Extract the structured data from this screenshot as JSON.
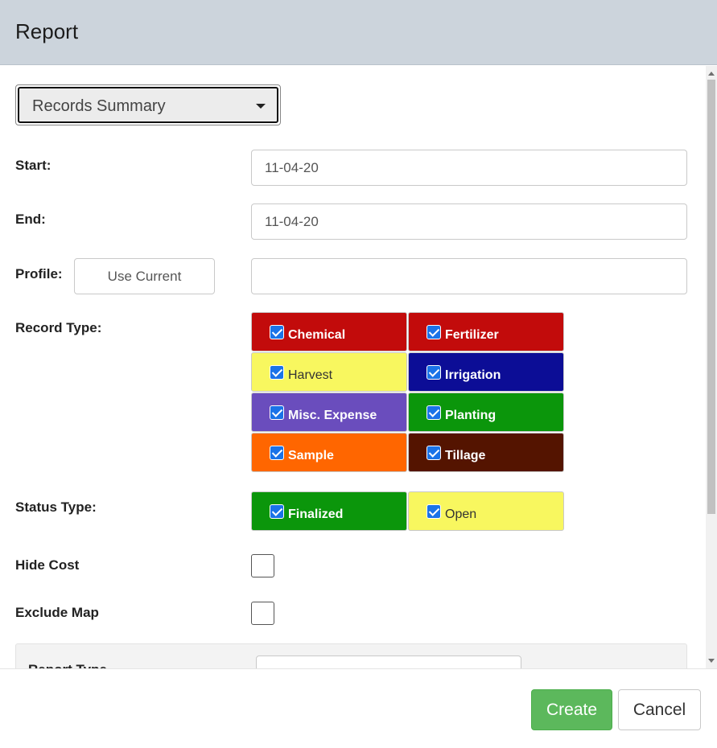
{
  "header": {
    "title": "Report"
  },
  "report_selector": {
    "selected": "Records Summary"
  },
  "fields": {
    "start": {
      "label": "Start:",
      "value": "11-04-20"
    },
    "end": {
      "label": "End:",
      "value": "11-04-20"
    },
    "profile": {
      "label": "Profile:",
      "button_label": "Use Current",
      "value": ""
    },
    "record_type": {
      "label": "Record Type:",
      "options": [
        {
          "label": "Chemical",
          "checked": true,
          "color": "#c20b0b",
          "text_style": "dark"
        },
        {
          "label": "Fertilizer",
          "checked": true,
          "color": "#c20b0b",
          "text_style": "dark"
        },
        {
          "label": "Harvest",
          "checked": true,
          "color": "#f8f75f",
          "text_style": "light"
        },
        {
          "label": "Irrigation",
          "checked": true,
          "color": "#0c0d96",
          "text_style": "dark"
        },
        {
          "label": "Misc. Expense",
          "checked": true,
          "color": "#6a4dbd",
          "text_style": "dark"
        },
        {
          "label": "Planting",
          "checked": true,
          "color": "#0b960b",
          "text_style": "dark"
        },
        {
          "label": "Sample",
          "checked": true,
          "color": "#ff6600",
          "text_style": "dark"
        },
        {
          "label": "Tillage",
          "checked": true,
          "color": "#541400",
          "text_style": "dark"
        }
      ]
    },
    "status_type": {
      "label": "Status Type:",
      "options": [
        {
          "label": "Finalized",
          "checked": true,
          "color": "#0b960b",
          "text_style": "dark"
        },
        {
          "label": "Open",
          "checked": true,
          "color": "#f8f75f",
          "text_style": "light"
        }
      ]
    },
    "hide_cost": {
      "label": "Hide Cost",
      "checked": false
    },
    "exclude_map": {
      "label": "Exclude Map",
      "checked": false
    },
    "report_type": {
      "label": "Report Type"
    }
  },
  "footer": {
    "create_label": "Create",
    "cancel_label": "Cancel"
  },
  "colors": {
    "header_bg": "#ccd4dc",
    "create_button": "#5cb85c",
    "checkbox_checked": "#1a73e8"
  }
}
